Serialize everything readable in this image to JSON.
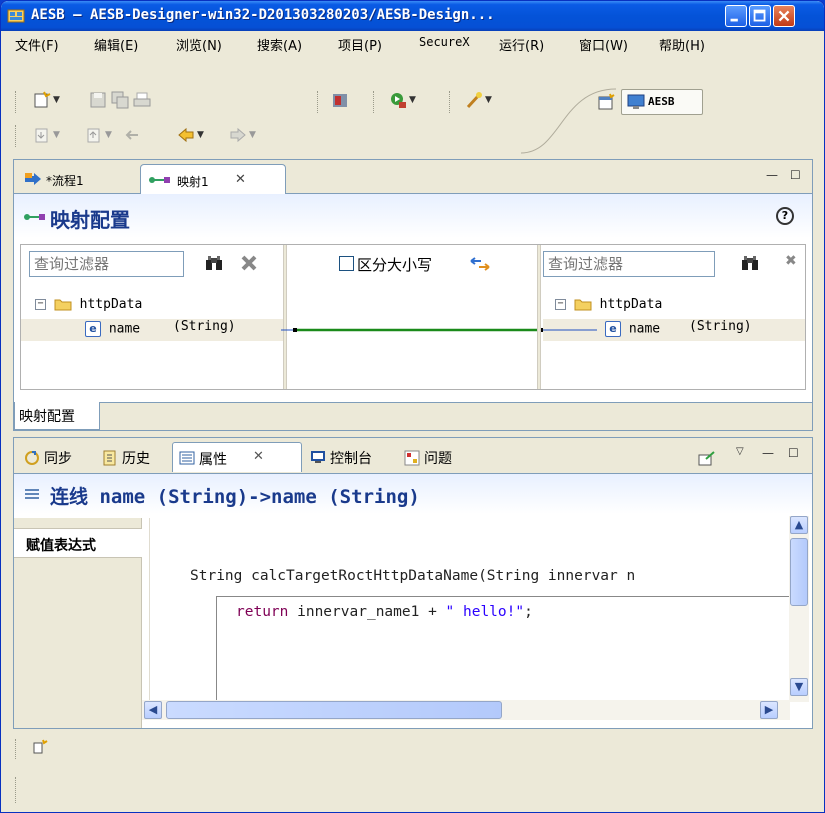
{
  "window": {
    "title": "AESB  —  AESB-Designer-win32-D201303280203/AESB-Design..."
  },
  "menu": [
    "文件(F)",
    "编辑(E)",
    "浏览(N)",
    "搜索(A)",
    "项目(P)",
    "SecureX",
    "运行(R)",
    "窗口(W)",
    "帮助(H)"
  ],
  "toolbar": {
    "perspective_label": "AESB"
  },
  "editor": {
    "tabs": [
      {
        "label": "*流程1",
        "active": false
      },
      {
        "label": "映射1",
        "active": true
      }
    ],
    "mapping_title": "映射配置",
    "left_filter_placeholder": "查询过滤器",
    "right_filter_placeholder": "查询过滤器",
    "case_sensitive_label": "区分大小写",
    "left_tree": {
      "root": "httpData",
      "child_name": "name",
      "child_type": "(String)"
    },
    "right_tree": {
      "root": "httpData",
      "child_name": "name",
      "child_type": "(String)"
    },
    "bottom_tab": "映射配置"
  },
  "properties": {
    "tabs": [
      {
        "label": "同步",
        "active": false
      },
      {
        "label": "历史",
        "active": false
      },
      {
        "label": "属性",
        "active": true
      },
      {
        "label": "控制台",
        "active": false
      },
      {
        "label": "问题",
        "active": false
      }
    ],
    "title_prefix": "连线",
    "title_expr": "name  (String)->name  (String)",
    "side_tab": "赋值表达式",
    "code_signature": "String calcTargetRoctHttpDataName(String innervar n",
    "code_return_kw": "return",
    "code_body": " innervar_name1 + ",
    "code_string": "\" hello!\"",
    "code_semicolon": ";"
  },
  "colors": {
    "title_bar": "#0453d8",
    "header_text": "#1a3a8c",
    "mapping_line": "#1a8a1a",
    "keyword": "#7f0055",
    "string": "#2a00ff"
  }
}
